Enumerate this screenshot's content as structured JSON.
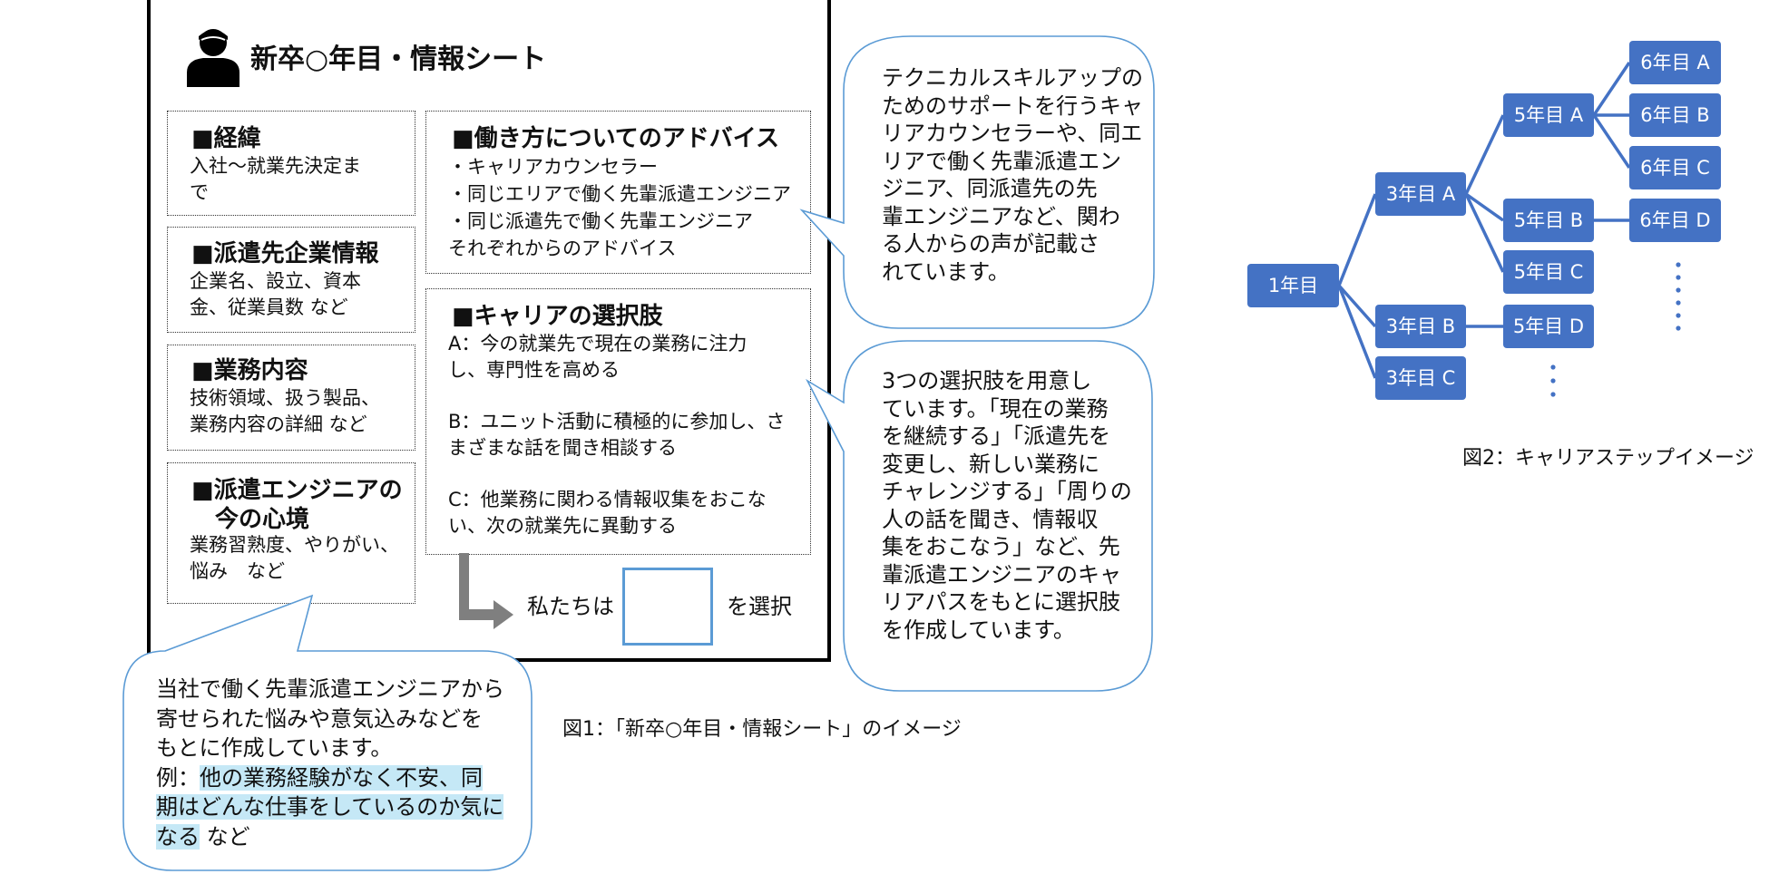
{
  "sheet": {
    "title": "新卒○年目・情報シート",
    "sections": [
      {
        "heading": "■経緯",
        "lines": [
          "入社～就業先決定ま",
          "で"
        ]
      },
      {
        "heading": "■派遣先企業情報",
        "lines": [
          "企業名、設立、資本",
          "金、従業員数 など"
        ]
      },
      {
        "heading": "■業務内容",
        "lines": [
          "技術領域、扱う製品、",
          "業務内容の詳細 など"
        ]
      },
      {
        "heading_lines": [
          "■派遣エンジニアの",
          "　今の心境"
        ],
        "lines": [
          "業務習熟度、やりがい、",
          "悩み　など"
        ]
      }
    ],
    "advice": {
      "heading": "■働き方についてのアドバイス",
      "lines": [
        "・キャリアカウンセラー",
        "・同じエリアで働く先輩派遣エンジニア",
        "・同じ派遣先で働く先輩エンジニア",
        "それぞれからのアドバイス"
      ]
    },
    "choices": {
      "heading": "■キャリアの選択肢",
      "a": [
        "A：今の就業先で現在の業務に注力",
        "し、専門性を高める"
      ],
      "b": [
        "B：ユニット活動に積極的に参加し、さ",
        "まざまな話を聞き相談する"
      ],
      "c": [
        "C：他業務に関わる情報収集をおこな",
        "い、次の就業先に異動する"
      ]
    },
    "select_prefix": "私たちは",
    "select_suffix": "を選択"
  },
  "callouts": {
    "advice": [
      "テクニカルスキルアップの",
      "ためのサポートを行うキャ",
      "リアカウンセラーや、同エ",
      "リアで働く先輩派遣エン",
      "ジニア、同派遣先の先",
      "輩エンジニアなど、関わ",
      "る人からの声が記載さ",
      "れています。"
    ],
    "choices": [
      "3つの選択肢を用意し",
      "ています。「現在の業務",
      "を継続する」「派遣先を",
      "変更し、新しい業務に",
      "チャレンジする」「周りの",
      "人の話を聞き、情報収",
      "集をおこなう」など、先",
      "輩派遣エンジニアのキャ",
      "リアパスをもとに選択肢",
      "を作成しています。"
    ],
    "mood": {
      "lines": [
        "当社で働く先輩派遣エンジニアから",
        "寄せられた悩みや意気込みなどを",
        "もとに作成しています。"
      ],
      "example_prefix": "例：",
      "example_hl1": "他の業務経験がなく不安、同",
      "example_hl2": "期はどんな仕事をしているのか気に",
      "example_hl3": "なる",
      "example_suffix": " など"
    }
  },
  "captions": {
    "fig1": "図1：「新卒○年目・情報シート」のイメージ",
    "fig2": "図2：キャリアステップイメージ"
  },
  "career_tree": {
    "color": "#4472c4",
    "nodes": {
      "y1": "1年目",
      "y3a": "3年目 A",
      "y3b": "3年目 B",
      "y3c": "3年目 C",
      "y5a": "5年目 A",
      "y5b": "5年目 B",
      "y5c": "5年目 C",
      "y5d": "5年目 D",
      "y6a": "6年目 A",
      "y6b": "6年目 B",
      "y6c": "6年目 C",
      "y6d": "6年目 D"
    }
  }
}
